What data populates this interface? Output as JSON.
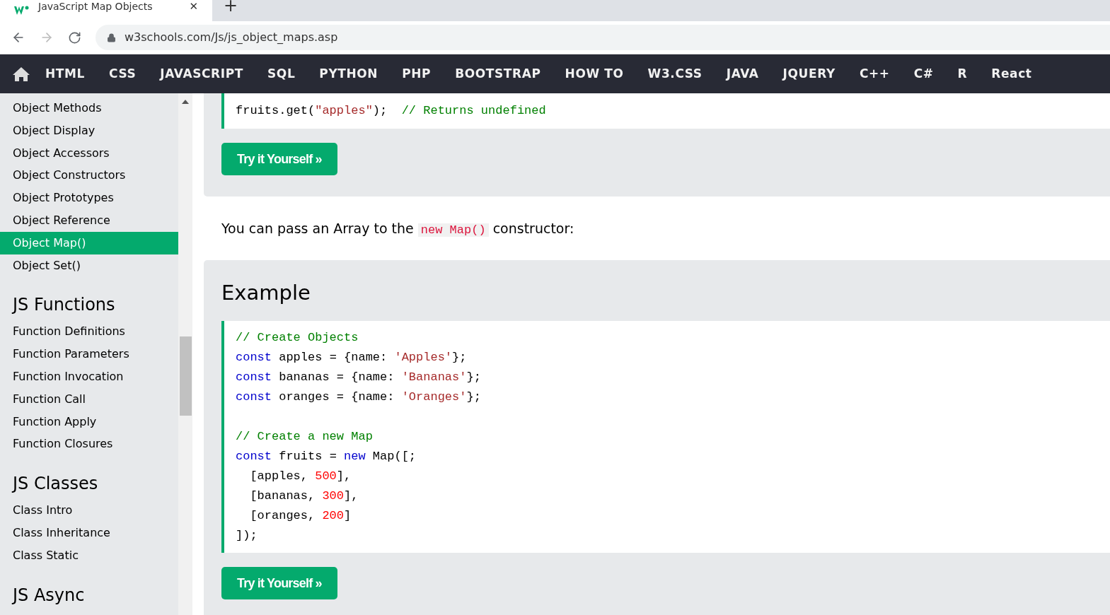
{
  "browser": {
    "tab": {
      "title": "JavaScript Map Objects",
      "close": "✕"
    },
    "new_tab": "+",
    "address": "w3schools.com/Js/js_object_maps.asp"
  },
  "nav": {
    "items": [
      "HTML",
      "CSS",
      "JAVASCRIPT",
      "SQL",
      "PYTHON",
      "PHP",
      "BOOTSTRAP",
      "HOW TO",
      "W3.CSS",
      "JAVA",
      "JQUERY",
      "C++",
      "C#",
      "R",
      "React"
    ]
  },
  "sidebar": {
    "groups": [
      {
        "items": [
          {
            "label": "Object Methods",
            "selected": false
          },
          {
            "label": "Object Display",
            "selected": false
          },
          {
            "label": "Object Accessors",
            "selected": false
          },
          {
            "label": "Object Constructors",
            "selected": false
          },
          {
            "label": "Object Prototypes",
            "selected": false
          },
          {
            "label": "Object Reference",
            "selected": false
          },
          {
            "label": "Object Map()",
            "selected": true
          },
          {
            "label": "Object Set()",
            "selected": false
          }
        ]
      },
      {
        "heading": "JS Functions",
        "items": [
          {
            "label": "Function Definitions",
            "selected": false
          },
          {
            "label": "Function Parameters",
            "selected": false
          },
          {
            "label": "Function Invocation",
            "selected": false
          },
          {
            "label": "Function Call",
            "selected": false
          },
          {
            "label": "Function Apply",
            "selected": false
          },
          {
            "label": "Function Closures",
            "selected": false
          }
        ]
      },
      {
        "heading": "JS Classes",
        "items": [
          {
            "label": "Class Intro",
            "selected": false
          },
          {
            "label": "Class Inheritance",
            "selected": false
          },
          {
            "label": "Class Static",
            "selected": false
          }
        ]
      },
      {
        "heading": "JS Async"
      }
    ]
  },
  "main": {
    "examples": [
      {
        "code": [
          [
            {
              "kind": "plain",
              "text": "fruits.get("
            },
            {
              "kind": "string",
              "text": "\"apples\""
            },
            {
              "kind": "plain",
              "text": ");  "
            },
            {
              "kind": "comment",
              "text": "// Returns undefined"
            }
          ]
        ],
        "button": "Try it Yourself »"
      },
      {
        "paragraph": {
          "before": "You can pass an Array to the ",
          "code": "new Map()",
          "after": " constructor:"
        },
        "heading": "Example",
        "code": [
          [
            {
              "kind": "comment",
              "text": "// Create Objects"
            }
          ],
          [
            {
              "kind": "keyword",
              "text": "const"
            },
            {
              "kind": "plain",
              "text": " apples = {name: "
            },
            {
              "kind": "string",
              "text": "'Apples'"
            },
            {
              "kind": "plain",
              "text": "};"
            }
          ],
          [
            {
              "kind": "keyword",
              "text": "const"
            },
            {
              "kind": "plain",
              "text": " bananas = {name: "
            },
            {
              "kind": "string",
              "text": "'Bananas'"
            },
            {
              "kind": "plain",
              "text": "};"
            }
          ],
          [
            {
              "kind": "keyword",
              "text": "const"
            },
            {
              "kind": "plain",
              "text": " oranges = {name: "
            },
            {
              "kind": "string",
              "text": "'Oranges'"
            },
            {
              "kind": "plain",
              "text": "};"
            }
          ],
          [
            {
              "kind": "gap"
            },
            {
              "kind": "comment",
              "text": "// Create a new Map"
            }
          ],
          [
            {
              "kind": "keyword",
              "text": "const"
            },
            {
              "kind": "plain",
              "text": " fruits = "
            },
            {
              "kind": "keyword",
              "text": "new"
            },
            {
              "kind": "plain",
              "text": " Map([;"
            }
          ],
          [
            {
              "kind": "plain",
              "text": "  [apples, "
            },
            {
              "kind": "number",
              "text": "500"
            },
            {
              "kind": "plain",
              "text": "],"
            }
          ],
          [
            {
              "kind": "plain",
              "text": "  [bananas, "
            },
            {
              "kind": "number",
              "text": "300"
            },
            {
              "kind": "plain",
              "text": "],"
            }
          ],
          [
            {
              "kind": "plain",
              "text": "  [oranges, "
            },
            {
              "kind": "number",
              "text": "200"
            },
            {
              "kind": "plain",
              "text": "]"
            }
          ],
          [
            {
              "kind": "plain",
              "text": "]);"
            }
          ]
        ],
        "button": "Try it Yourself »"
      }
    ]
  }
}
